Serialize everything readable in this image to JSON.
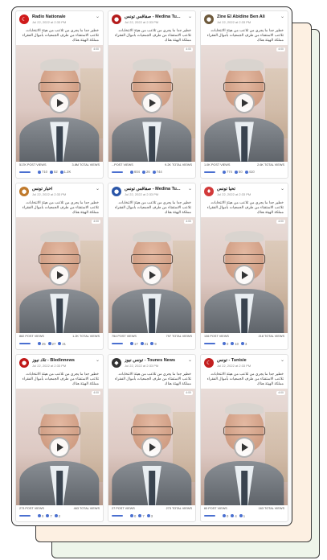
{
  "colors": {
    "accent": "#4a6fd0",
    "page_back": "#eef5ea",
    "page_mid": "#fdf0e2"
  },
  "cards": [
    {
      "name": "Radio Nationale",
      "date": "Jul 22, 2022 at 2:33 PM",
      "avatar_color": "#d01a1a",
      "avatar_glyph": "☾",
      "caption": "خطير جدا ما يجري من تلاعب من هيئة الانتخابات. تلاعب الاستفتاء من طرف الجمعيات بأموال الفقراء مملكة الهيئة هناك",
      "badge": "4:00",
      "post_views": "517K POST VIEWS",
      "total_views": "3.8M TOTAL VIEWS",
      "reactions": [
        "710",
        "52",
        "1.2K"
      ]
    },
    {
      "name": "صفاقس تونس - Medina Tu...",
      "date": "Jul 22, 2022 at 2:33 PM",
      "avatar_color": "#b41c1c",
      "avatar_glyph": "●",
      "caption": "خطير جدا ما يجري من تلاعب من هيئة الانتخابات. تلاعب الاستفتاء من طرف الجمعيات بأموال الفقراء مملكة الهيئة هناك",
      "badge": "4:00",
      "post_views": "...POST VIEWS",
      "total_views": "9.2K TOTAL VIEWS",
      "reactions": [
        "604",
        "26",
        "744"
      ]
    },
    {
      "name": "Zine El Abidine Ben Ali",
      "date": "Jul 22, 2022 at 2:33 PM",
      "avatar_color": "#6e5a3c",
      "avatar_glyph": "●",
      "caption": "خطير جدا ما يجري من تلاعب من هيئة الانتخابات. تلاعب الاستفتاء من طرف الجمعيات بأموال الفقراء مملكة الهيئة هناك",
      "badge": "4:00",
      "post_views": "1.0K POST VIEWS",
      "total_views": "2.6K TOTAL VIEWS",
      "reactions": [
        "774",
        "50",
        "410"
      ]
    },
    {
      "name": "أخبار تونس",
      "date": "Jul 22, 2022 at 2:33 PM",
      "avatar_color": "#c07a2c",
      "avatar_glyph": "●",
      "caption": "خطير جدا ما يجري من تلاعب من هيئة الانتخابات. تلاعب الاستفتاء من طرف الجمعيات بأموال الفقراء مملكة الهيئة هناك",
      "badge": "4:00",
      "post_views": "882 POST VIEWS",
      "total_views": "1.2K TOTAL VIEWS",
      "reactions": [
        "25",
        "27",
        "21"
      ]
    },
    {
      "name": "صفاقس تونس - Medina Tu...",
      "date": "Jul 22, 2022 at 2:33 PM",
      "avatar_color": "#2b56a8",
      "avatar_glyph": "●",
      "caption": "خطير جدا ما يجري من تلاعب من هيئة الانتخابات. تلاعب الاستفتاء من طرف الجمعيات بأموال الفقراء مملكة الهيئة هناك",
      "badge": "4:00",
      "post_views": "754 POST VIEWS",
      "total_views": "797 TOTAL VIEWS",
      "reactions": [
        "17",
        "21",
        "9"
      ]
    },
    {
      "name": "تحيا تونس",
      "date": "Jul 22, 2022 at 2:33 PM",
      "avatar_color": "#d23a3a",
      "avatar_glyph": "♦",
      "caption": "خطير جدا ما يجري من تلاعب من هيئة الانتخابات. تلاعب الاستفتاء من طرف الجمعيات بأموال الفقراء مملكة الهيئة هناك",
      "badge": "4:00",
      "post_views": "136 POST VIEWS",
      "total_views": "218 TOTAL VIEWS",
      "reactions": [
        "0",
        "10",
        "3"
      ]
    },
    {
      "name": "تلاد نيوز - Bledinnews",
      "date": "Jul 22, 2022 at 2:33 PM",
      "avatar_color": "#c01818",
      "avatar_glyph": "●",
      "caption": "خطير جدا ما يجري من تلاعب من هيئة الانتخابات. تلاعب الاستفتاء من طرف الجمعيات بأموال الفقراء مملكة الهيئة هناك",
      "badge": "4:00",
      "post_views": "273 POST VIEWS",
      "total_views": "463 TOTAL VIEWS",
      "reactions": [
        "0",
        "7",
        "2"
      ]
    },
    {
      "name": "تونس نيوز - Tounes News",
      "date": "Jul 22, 2022 at 2:33 PM",
      "avatar_color": "#333333",
      "avatar_glyph": "◆",
      "caption": "خطير جدا ما يجري من تلاعب من هيئة الانتخابات. تلاعب الاستفتاء من طرف الجمعيات بأموال الفقراء مملكة الهيئة هناك",
      "badge": "4:00",
      "post_views": "27 POST VIEWS",
      "total_views": "273 TOTAL VIEWS",
      "reactions": [
        "0",
        "7",
        "3"
      ]
    },
    {
      "name": "تونس - Tunisie",
      "date": "Jul 22, 2022 at 2:33 PM",
      "avatar_color": "#c21f1f",
      "avatar_glyph": "☾",
      "caption": "خطير جدا ما يجري من تلاعب من هيئة الانتخابات. تلاعب الاستفتاء من طرف الجمعيات بأموال الفقراء مملكة الهيئة هناك",
      "badge": "4:00",
      "post_views": "60 POST VIEWS",
      "total_views": "163 TOTAL VIEWS",
      "reactions": [
        "0",
        "4",
        "1"
      ]
    }
  ],
  "icons": {
    "play": "play-icon",
    "more": "chevron-down-icon"
  }
}
